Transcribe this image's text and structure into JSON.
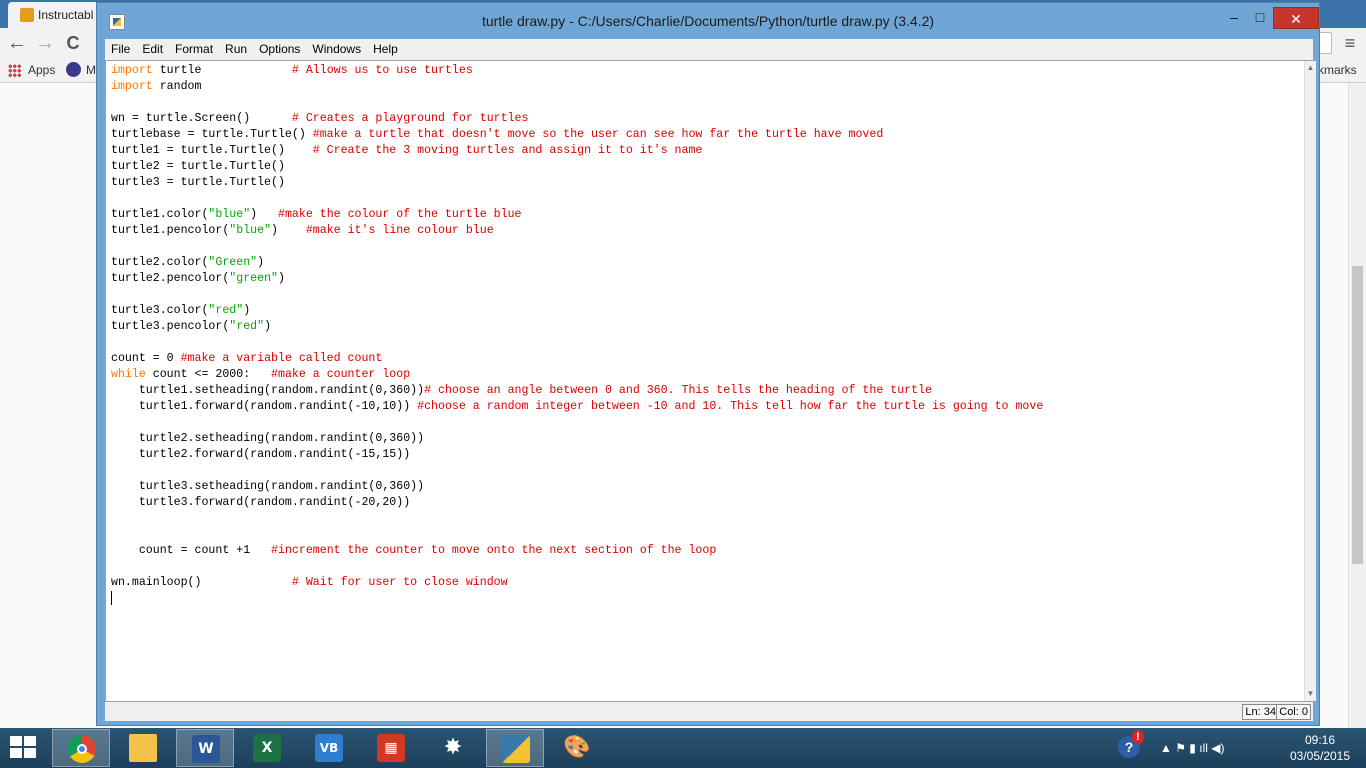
{
  "browser": {
    "tab_label": "Instructabl",
    "apps_label": "Apps",
    "bookmark2_label": "M",
    "bookmarks_right": "kmarks",
    "nav_back": "←",
    "nav_forward": "→",
    "nav_reload": "C",
    "menu_glyph": "≡"
  },
  "window": {
    "title": "turtle draw.py - C:/Users/Charlie/Documents/Python/turtle draw.py (3.4.2)",
    "minimize": "–",
    "maximize": "□",
    "close": "✕"
  },
  "menubar": [
    "File",
    "Edit",
    "Format",
    "Run",
    "Options",
    "Windows",
    "Help"
  ],
  "code_lines": [
    [
      [
        "kw",
        "import"
      ],
      [
        "n",
        " turtle             "
      ],
      [
        "c",
        "# Allows us to use turtles"
      ]
    ],
    [
      [
        "kw",
        "import"
      ],
      [
        "n",
        " random"
      ]
    ],
    [],
    [
      [
        "n",
        "wn = turtle.Screen()      "
      ],
      [
        "c",
        "# Creates a playground for turtles"
      ]
    ],
    [
      [
        "n",
        "turtlebase = turtle.Turtle() "
      ],
      [
        "c",
        "#make a turtle that doesn't move so the user can see how far the turtle have moved"
      ]
    ],
    [
      [
        "n",
        "turtle1 = turtle.Turtle()    "
      ],
      [
        "c",
        "# Create the 3 moving turtles and assign it to it's name"
      ]
    ],
    [
      [
        "n",
        "turtle2 = turtle.Turtle()"
      ]
    ],
    [
      [
        "n",
        "turtle3 = turtle.Turtle()"
      ]
    ],
    [],
    [
      [
        "n",
        "turtle1.color("
      ],
      [
        "s",
        "\"blue\""
      ],
      [
        "n",
        ")   "
      ],
      [
        "c",
        "#make the colour of the turtle blue"
      ]
    ],
    [
      [
        "n",
        "turtle1.pencolor("
      ],
      [
        "s",
        "\"blue\""
      ],
      [
        "n",
        ")    "
      ],
      [
        "c",
        "#make it's line colour blue"
      ]
    ],
    [],
    [
      [
        "n",
        "turtle2.color("
      ],
      [
        "s",
        "\"Green\""
      ],
      [
        "n",
        ")"
      ]
    ],
    [
      [
        "n",
        "turtle2.pencolor("
      ],
      [
        "s",
        "\"green\""
      ],
      [
        "n",
        ")"
      ]
    ],
    [],
    [
      [
        "n",
        "turtle3.color("
      ],
      [
        "s",
        "\"red\""
      ],
      [
        "n",
        ")"
      ]
    ],
    [
      [
        "n",
        "turtle3.pencolor("
      ],
      [
        "s",
        "\"red\""
      ],
      [
        "n",
        ")"
      ]
    ],
    [],
    [
      [
        "n",
        "count = 0 "
      ],
      [
        "c",
        "#make a variable called count"
      ]
    ],
    [
      [
        "kw",
        "while"
      ],
      [
        "n",
        " count <= 2000:   "
      ],
      [
        "c",
        "#make a counter loop"
      ]
    ],
    [
      [
        "n",
        "    turtle1.setheading(random.randint(0,360))"
      ],
      [
        "c",
        "# choose an angle between 0 and 360. This tells the heading of the turtle"
      ]
    ],
    [
      [
        "n",
        "    turtle1.forward(random.randint(-10,10)) "
      ],
      [
        "c",
        "#choose a random integer between -10 and 10. This tell how far the turtle is going to move"
      ]
    ],
    [],
    [
      [
        "n",
        "    turtle2.setheading(random.randint(0,360))"
      ]
    ],
    [
      [
        "n",
        "    turtle2.forward(random.randint(-15,15))"
      ]
    ],
    [],
    [
      [
        "n",
        "    turtle3.setheading(random.randint(0,360))"
      ]
    ],
    [
      [
        "n",
        "    turtle3.forward(random.randint(-20,20))"
      ]
    ],
    [],
    [],
    [
      [
        "n",
        "    count = count +1   "
      ],
      [
        "c",
        "#increment the counter to move onto the next section of the loop"
      ]
    ],
    [],
    [
      [
        "n",
        "wn.mainloop()             "
      ],
      [
        "c",
        "# Wait for user to close window"
      ]
    ],
    []
  ],
  "status": {
    "ln": "Ln: 34",
    "col": "Col: 0"
  },
  "taskbar": {
    "apps": [
      {
        "name": "chrome",
        "label": ""
      },
      {
        "name": "file-explorer",
        "label": ""
      },
      {
        "name": "word",
        "label": "W"
      },
      {
        "name": "excel",
        "label": "X"
      },
      {
        "name": "visual-basic",
        "label": "VB"
      },
      {
        "name": "red-app",
        "label": "▦"
      },
      {
        "name": "web-app",
        "label": "✸"
      },
      {
        "name": "python-idle",
        "label": ""
      },
      {
        "name": "paint",
        "label": "🎨"
      }
    ],
    "tray_icons": "▲  ⚑  ▮  ıll  ◀)",
    "time": "09:16",
    "date": "03/05/2015"
  },
  "colors": {
    "keyword": "#ff7700",
    "string": "#00aa00",
    "comment": "#dd0000",
    "close_button": "#c7362d",
    "window_frame": "#6fa6d6"
  }
}
